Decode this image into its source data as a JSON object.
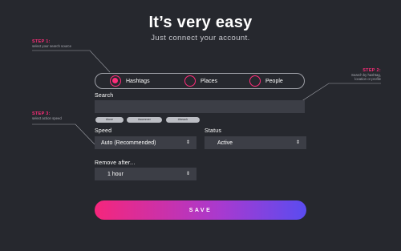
{
  "header": {
    "title": "It’s very easy",
    "subtitle": "Just connect your account."
  },
  "steps": {
    "step1": {
      "title": "STEP 1:",
      "desc": "select your search source"
    },
    "step2": {
      "title": "STEP 2:",
      "desc_line1": "Search by hashtag,",
      "desc_line2": "location or profile"
    },
    "step3": {
      "title": "STEP 3:",
      "desc": "select action speed"
    }
  },
  "source_options": [
    {
      "label": "Hashtags",
      "selected": true
    },
    {
      "label": "Places",
      "selected": false
    },
    {
      "label": "People",
      "selected": false
    }
  ],
  "search": {
    "label": "Search",
    "value": "",
    "tags": [
      "#love",
      "#summer",
      "#beach"
    ]
  },
  "speed": {
    "label": "Speed",
    "value": "Auto (Recommended)"
  },
  "status": {
    "label": "Status",
    "value": "Active"
  },
  "remove_after": {
    "label": "Remove after...",
    "value": "1 hour"
  },
  "save": {
    "label": "SAVE"
  },
  "colors": {
    "background": "#26282e",
    "accent": "#ff2d7a",
    "field": "#3c3e46",
    "gradient_start": "#f5267c",
    "gradient_end": "#5a4cf0"
  }
}
